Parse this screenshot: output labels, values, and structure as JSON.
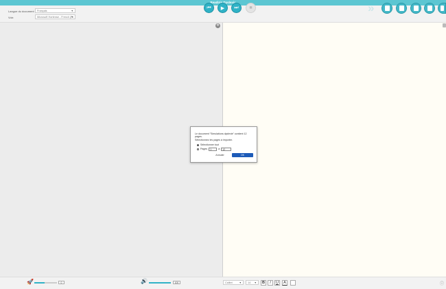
{
  "window": {
    "title": "Readiris Dyslexic"
  },
  "toolbar": {
    "language_label": "Langue du document",
    "language_value": "Français",
    "voice_label": "Voix",
    "voice_value": "Microsoft Hortense - French (Fr"
  },
  "dialog": {
    "message": "Le document \"Simulations dyslexie\" contient 12 pages.",
    "select_prompt": "Sélectionnez les pages à importer.",
    "option_all": "Sélectionner tout",
    "option_pages": "Pages",
    "from_page": "1",
    "to_label": "à",
    "to_page": "12",
    "cancel_label": "Annuler",
    "ok_label": "OK"
  },
  "statusbar": {
    "speed_value": "0",
    "volume_value": "100",
    "font_value": "Calibri",
    "size_value": "14",
    "bold": "B",
    "italic": "I",
    "underline": "U",
    "font_color": "A"
  },
  "colors": {
    "accent": "#2fb2c6",
    "title_bar": "#5cc6d2",
    "ok_button": "#1d5bb8"
  }
}
